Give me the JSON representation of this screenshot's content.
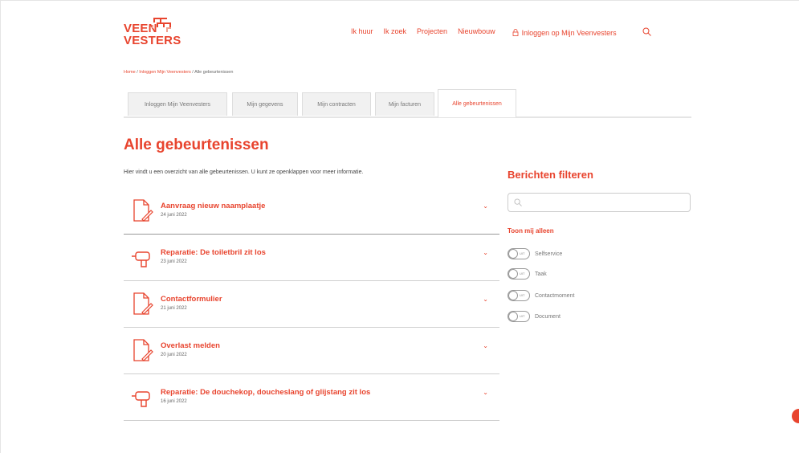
{
  "brand": {
    "line1": "VEEN",
    "line2": "VESTERS",
    "color": "#e8442e"
  },
  "nav": {
    "items": [
      "Ik huur",
      "Ik zoek",
      "Projecten",
      "Nieuwbouw"
    ],
    "login": "Inloggen op Mijn Veenvesters",
    "login_icon": "lock-icon",
    "search_icon": "search-icon"
  },
  "breadcrumb": {
    "home": "Home",
    "sep": " / ",
    "parent": "Inloggen Mijn Veenvesters",
    "current": "Alle gebeurtenissen"
  },
  "tabs": [
    "Inloggen Mijn Veenvesters",
    "Mijn gegevens",
    "Mijn contracten",
    "Mijn facturen",
    "Alle gebeurtenissen"
  ],
  "active_tab": 4,
  "page": {
    "title": "Alle gebeurtenissen",
    "intro": "Hier vindt u een overzicht van alle gebeurtenissen. U kunt ze openklappen voor meer informatie."
  },
  "events": [
    {
      "title": "Aanvraag nieuw naamplaatje",
      "date": "24 juni 2022",
      "icon": "document-icon"
    },
    {
      "title": "Reparatie: De toiletbril zit los",
      "date": "23 juni 2022",
      "icon": "drill-icon"
    },
    {
      "title": "Contactformulier",
      "date": "21 juni 2022",
      "icon": "document-icon"
    },
    {
      "title": "Overlast melden",
      "date": "20 juni 2022",
      "icon": "document-icon"
    },
    {
      "title": "Reparatie: De douchekop, doucheslang of glijstang zit los",
      "date": "16 juni 2022",
      "icon": "drill-icon"
    }
  ],
  "filter": {
    "title": "Berichten filteren",
    "search_placeholder": "",
    "toon": "Toon mij alleen",
    "toggle_state": "UIT",
    "options": [
      "Selfservice",
      "Taak",
      "Contactmoment",
      "Document"
    ]
  }
}
